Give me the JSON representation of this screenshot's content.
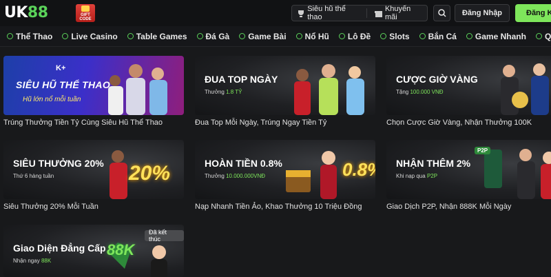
{
  "header": {
    "logo_main": "UK",
    "logo_accent": "88",
    "gift_code": "GIFT CODE",
    "sieu_hu_label": "Siêu hũ thể thao",
    "khuyen_mai_label": "Khuyến mãi",
    "login_label": "Đăng Nhập",
    "register_label": "Đăng Ký"
  },
  "nav": {
    "items": [
      {
        "label": "Thể Thao",
        "icon": "soccer-icon"
      },
      {
        "label": "Live Casino",
        "icon": "casino-chip-icon"
      },
      {
        "label": "Table Games",
        "icon": "cards-icon"
      },
      {
        "label": "Đá Gà",
        "icon": "rooster-icon"
      },
      {
        "label": "Game Bài",
        "icon": "playing-card-icon"
      },
      {
        "label": "Nổ Hũ",
        "icon": "jackpot-icon"
      },
      {
        "label": "Lô Đề",
        "icon": "lottery-icon"
      },
      {
        "label": "Slots",
        "icon": "slot-icon"
      },
      {
        "label": "Bắn Cá",
        "icon": "fish-icon"
      },
      {
        "label": "Game Nhanh",
        "icon": "rocket-icon"
      },
      {
        "label": "Quay",
        "icon": "wheel-icon"
      }
    ]
  },
  "promos": [
    {
      "title": "SIÊU HŨ THỂ THAO",
      "sub": "Hũ lớn nổ mỗi tuần",
      "brand": "K+",
      "caption": "Trúng Thưởng Tiền Tỷ Cùng Siêu Hũ Thể Thao"
    },
    {
      "title": "ĐUA TOP NGÀY",
      "sub_prefix": "Thưởng",
      "sub_value": "1.8 TỶ",
      "caption": "Đua Top Mỗi Ngày, Trúng Ngay Tiền Tỷ"
    },
    {
      "title": "CƯỢC GIỜ VÀNG",
      "sub_prefix": "Tặng",
      "sub_value": "100.000 VNĐ",
      "caption": "Chọn Cược Giờ Vàng, Nhận Thưởng 100K"
    },
    {
      "title": "SIÊU THƯỞNG 20%",
      "sub_prefix": "Thứ 6 hàng tuần",
      "sub_value": "",
      "big": "20%",
      "caption": "Siêu Thưởng 20% Mỗi Tuần"
    },
    {
      "title": "HOÀN TIỀN 0.8%",
      "sub_prefix": "Thưởng",
      "sub_value": "10.000.000VNĐ",
      "big": "0.8%",
      "caption": "Nạp Nhanh Tiền Ảo, Khao Thưởng 10 Triệu Đồng"
    },
    {
      "title": "NHẬN THÊM 2%",
      "sub_prefix": "Khi nạp qua",
      "sub_value": "P2P",
      "badge": "P2P",
      "caption": "Giao Dịch P2P, Nhận 888K Mỗi Ngày"
    },
    {
      "title": "Giao Diện Đẳng Cấp",
      "sub_prefix": "Nhận ngay",
      "sub_value": "88K",
      "big": "88K",
      "ended": "Đã kết thúc",
      "caption": ""
    }
  ],
  "colors": {
    "accent": "#7ee65b",
    "bg": "#18191b",
    "gold": "#ffe15a"
  }
}
